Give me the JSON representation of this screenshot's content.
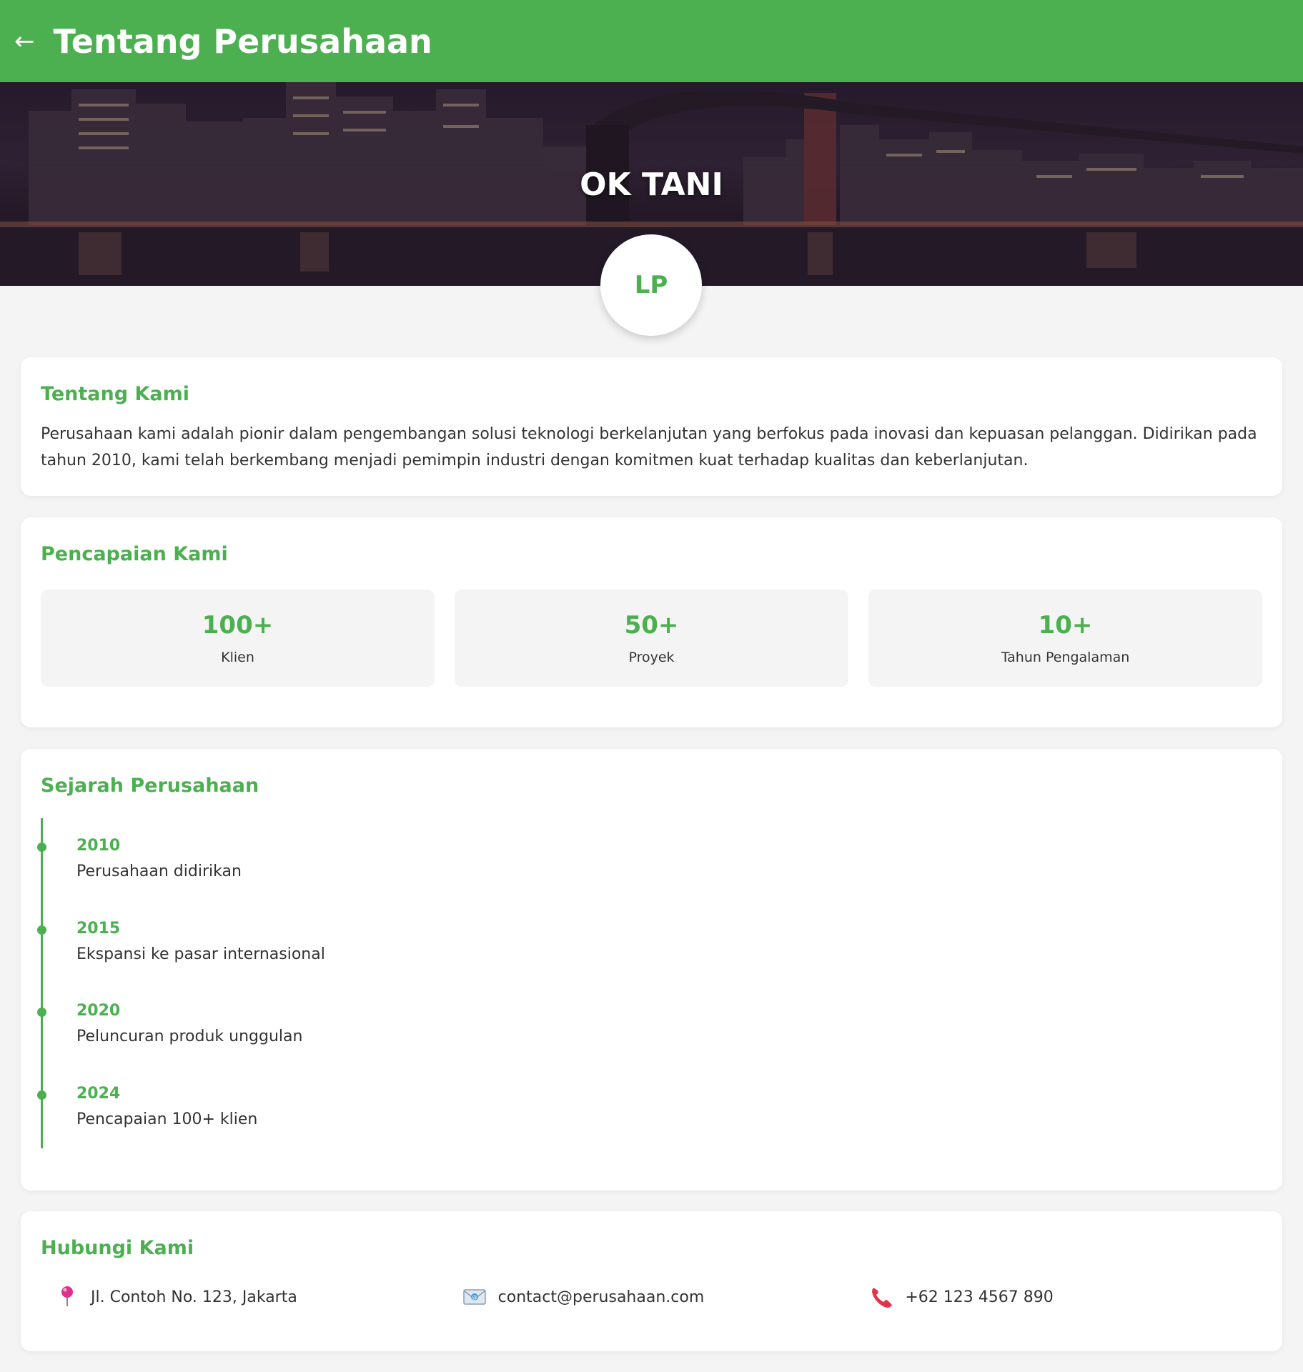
{
  "header": {
    "back_label": "←",
    "title": "Tentang Perusahaan"
  },
  "hero": {
    "company_name": "OK TANI",
    "logo_initials": "LP"
  },
  "about": {
    "title": "Tentang Kami",
    "text": "Perusahaan kami adalah pionir dalam pengembangan solusi teknologi berkelanjutan yang berfokus pada inovasi dan kepuasan pelanggan. Didirikan pada tahun 2010, kami telah berkembang menjadi pemimpin industri dengan komitmen kuat terhadap kualitas dan keberlanjutan."
  },
  "achievements": {
    "title": "Pencapaian Kami",
    "items": [
      {
        "value": "100+",
        "label": "Klien"
      },
      {
        "value": "50+",
        "label": "Proyek"
      },
      {
        "value": "10+",
        "label": "Tahun Pengalaman"
      }
    ]
  },
  "history": {
    "title": "Sejarah Perusahaan",
    "events": [
      {
        "year": "2010",
        "desc": "Perusahaan didirikan"
      },
      {
        "year": "2015",
        "desc": "Ekspansi ke pasar internasional"
      },
      {
        "year": "2020",
        "desc": "Peluncuran produk unggulan"
      },
      {
        "year": "2024",
        "desc": "Pencapaian 100+ klien"
      }
    ]
  },
  "contact": {
    "title": "Hubungi Kami",
    "address": {
      "icon": "map-pin-icon",
      "text": "Jl. Contoh No. 123, Jakarta"
    },
    "email": {
      "icon": "email-icon",
      "text": "contact@perusahaan.com"
    },
    "phone": {
      "icon": "phone-icon",
      "text": "+62 123 4567 890"
    }
  },
  "colors": {
    "primary": "#4caf50",
    "background": "#f4f4f4",
    "card": "#ffffff",
    "text": "#333333"
  }
}
